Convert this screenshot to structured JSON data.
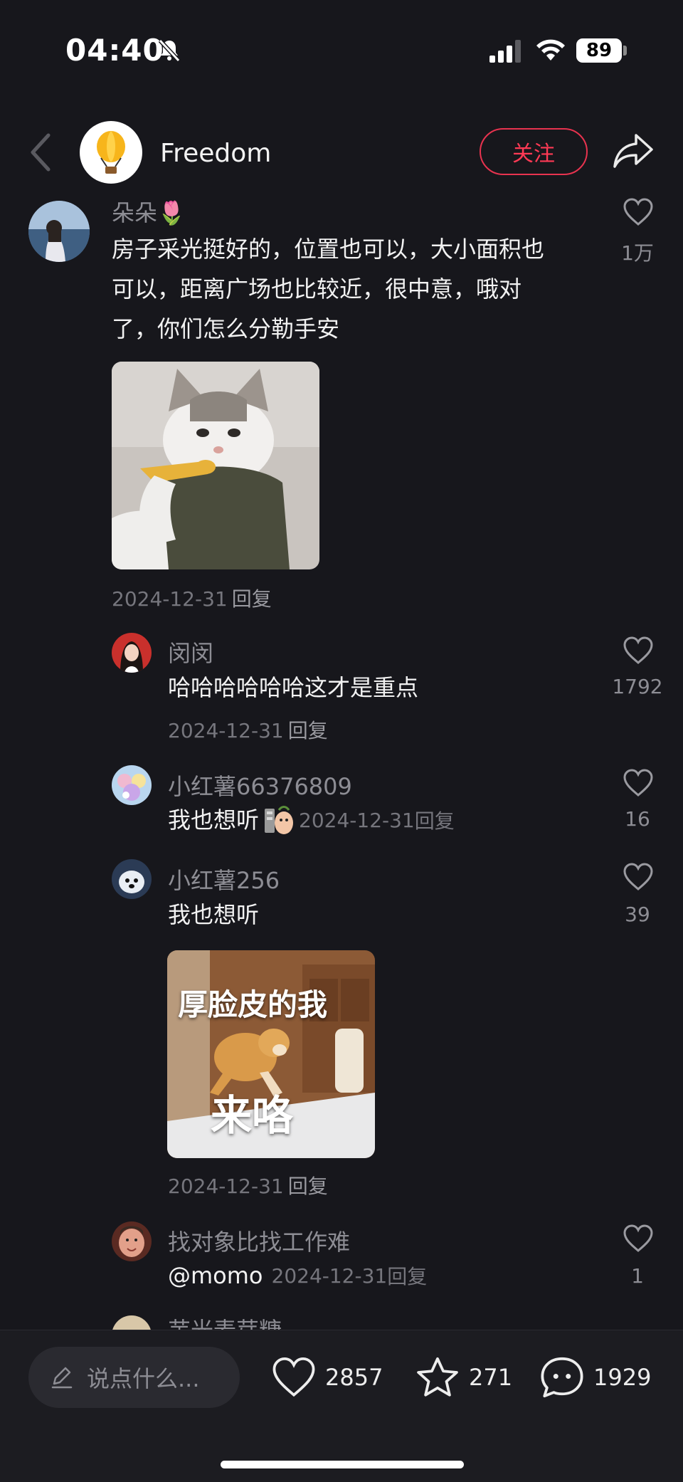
{
  "status_bar": {
    "time": "04:40",
    "battery": "89",
    "icons": [
      "mute-icon",
      "signal-icon",
      "wifi-icon",
      "battery-icon"
    ]
  },
  "header": {
    "author_name": "Freedom",
    "follow_label": "关注",
    "icons": [
      "back-icon",
      "balloon-avatar",
      "share-icon"
    ]
  },
  "comments": [
    {
      "username": "朵朵🌷",
      "lines": [
        "房子采光挺好的，位置也可以，大小面积也",
        "可以，距离广场也比较近，很中意，哦对",
        "了，你们怎么分勒手安"
      ],
      "date": "2024-12-31",
      "reply": "回复",
      "likes": "1万"
    },
    {
      "username": "闵闵",
      "text": "哈哈哈哈哈哈这才是重点",
      "date": "2024-12-31",
      "reply": "回复",
      "likes": "1792"
    },
    {
      "username": "小红薯66376809",
      "text": "我也想听",
      "date": "2024-12-31",
      "reply": "回复",
      "likes": "16"
    },
    {
      "username": "小红薯256",
      "text": "我也想听",
      "date": "2024-12-31",
      "reply": "回复",
      "likes": "39",
      "sticker_top": "厚脸皮的我",
      "sticker_bottom": "来咯"
    },
    {
      "username": "找对象比找工作难",
      "text": "@momo",
      "date": "2024-12-31",
      "reply": "回复",
      "likes": "1"
    },
    {
      "username": "芋光麦芽糖"
    }
  ],
  "bottom_bar": {
    "input_placeholder": "说点什么...",
    "likes": "2857",
    "favorites": "271",
    "comments": "1929"
  },
  "colors": {
    "background": "#17171c",
    "accent": "#ff3a55",
    "text_secondary": "#8d8d94"
  }
}
